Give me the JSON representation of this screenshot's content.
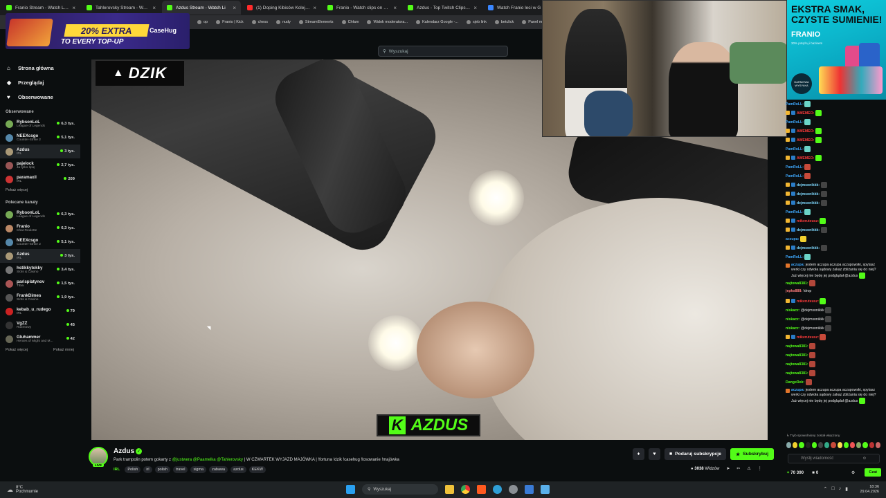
{
  "browser": {
    "tabs": [
      {
        "title": "Franio Stream - Watch Live on",
        "color": "#53fc18",
        "active": false
      },
      {
        "title": "Tahlerovsky Stream - Watch Li",
        "color": "#53fc18",
        "active": false
      },
      {
        "title": "Azdus Stream - Watch Li",
        "color": "#53fc18",
        "active": true
      },
      {
        "title": "(1) Doping Kibiców Kolejorza",
        "color": "#ff2b2b",
        "active": false
      },
      {
        "title": "Franio - Watch clips on Kick",
        "color": "#53fc18",
        "active": false
      },
      {
        "title": "Azdus - Top Twitch Clips - Twi",
        "color": "#53fc18",
        "active": false
      },
      {
        "title": "Watch Franio leci w G",
        "color": "#3a86ff",
        "active": false
      }
    ],
    "bookmarks": [
      "op",
      "Franio | Kick",
      "chess",
      "nudy",
      "StreamElements",
      "Chłam",
      "Widok moderatora...",
      "Kalendarz Google -...",
      "sjeb link",
      "betclick",
      "Panel mode"
    ]
  },
  "ad_banner": {
    "line1": "20% EXTRA",
    "line2": "TO EVERY TOP-UP",
    "brand": "CaseHug"
  },
  "search": {
    "placeholder": "Wyszukaj"
  },
  "sidebar": {
    "nav": [
      {
        "label": "Strona główna",
        "icon": "home-icon"
      },
      {
        "label": "Przeglądaj",
        "icon": "compass-icon"
      },
      {
        "label": "Obserwowane",
        "icon": "heart-icon"
      }
    ],
    "followed_header": "Obserwowane",
    "followed": [
      {
        "name": "RybsonLoL",
        "cat": "League of Legends",
        "viewers": "6,3 tys.",
        "color": "#7a5"
      },
      {
        "name": "NEEXcsgo",
        "cat": "Counter-Strike 2",
        "viewers": "5,1 tys.",
        "color": "#58a"
      },
      {
        "name": "Azdus",
        "cat": "IRL",
        "viewers": "3 tys.",
        "color": "#a97",
        "selected": true
      },
      {
        "name": "pajelock",
        "cat": "Ja tylko śpię",
        "viewers": "2,7 tys.",
        "color": "#955"
      },
      {
        "name": "paramaxil",
        "cat": "IRL",
        "viewers": "209",
        "color": "#c33"
      }
    ],
    "followed_more": "Pokaż więcej",
    "recommended_header": "Polecane kanały",
    "recommended": [
      {
        "name": "RybsonLoL",
        "cat": "League of Legends",
        "viewers": "6,3 tys.",
        "color": "#7a5"
      },
      {
        "name": "Franio",
        "cat": "Chat Roulette",
        "viewers": "6,3 tys.",
        "color": "#b86"
      },
      {
        "name": "NEEXcsgo",
        "cat": "Counter-Strike 2",
        "viewers": "5,1 tys.",
        "color": "#58a"
      },
      {
        "name": "Azdus",
        "cat": "IRL",
        "viewers": "3 tys.",
        "color": "#a97",
        "selected": true
      },
      {
        "name": "hstikkytokky",
        "cat": "Slots & Casino",
        "viewers": "3,4 tys.",
        "color": "#777"
      },
      {
        "name": "parisplatynov",
        "cat": "Tibia",
        "viewers": "1,5 tys.",
        "color": "#a55"
      },
      {
        "name": "FrankDimes",
        "cat": "Slots & Casino",
        "viewers": "1,9 tys.",
        "color": "#555"
      },
      {
        "name": "kebab_u_rudego",
        "cat": "IRL",
        "viewers": "79",
        "color": "#c22"
      },
      {
        "name": "VgZZ",
        "cat": "Rozmowy",
        "viewers": "45",
        "color": "#333"
      },
      {
        "name": "Gluhammer",
        "cat": "Heroes of Might and M...",
        "viewers": "42",
        "color": "#665"
      }
    ],
    "more": "Pokaż więcej",
    "less": "Pokaż mniej"
  },
  "overlay": {
    "dzik": "DZIK",
    "kick_k": "K",
    "kick_name": "AZDUS"
  },
  "webcam_ad": {
    "line1": "EKSTRA SMAK,",
    "line2": "CZYSTE SUMIENIE!",
    "brand": "FRANIO",
    "sub": "30% potężej i bazinem",
    "badge": "DARMOWA WYSYŁKA"
  },
  "chat": {
    "messages": [
      {
        "user": "PamRoLL:",
        "ucolor": "#3fa9ff",
        "text": "",
        "emote": "#6bd4c8"
      },
      {
        "user": "AWEMEO:",
        "ucolor": "#ff3b3b",
        "text": "",
        "emote": "#53fc18",
        "badges": true
      },
      {
        "user": "PamRoLL:",
        "ucolor": "#3fa9ff",
        "text": "",
        "emote": "#6bd4c8"
      },
      {
        "user": "AWEMEO:",
        "ucolor": "#ff3b3b",
        "text": "",
        "emote": "#53fc18",
        "badges": true
      },
      {
        "user": "AWEMEO:",
        "ucolor": "#ff3b3b",
        "text": "",
        "emote": "#53fc18",
        "badges": true
      },
      {
        "user": "PamRoLL:",
        "ucolor": "#3fa9ff",
        "text": "",
        "emote": "#6bd4c8"
      },
      {
        "user": "AWEMEO:",
        "ucolor": "#ff3b3b",
        "text": "",
        "emote": "#53fc18",
        "badges": true
      },
      {
        "user": "PamRoLL:",
        "ucolor": "#3fa9ff",
        "text": "",
        "emote": "#c84a3a"
      },
      {
        "user": "PamRoLL:",
        "ucolor": "#3fa9ff",
        "text": "",
        "emote": "#c84a3a"
      },
      {
        "user": "dejmsonikkk:",
        "ucolor": "#7fd9ff",
        "text": "",
        "emote": "#444",
        "badges": true
      },
      {
        "user": "dejmsonikkk:",
        "ucolor": "#7fd9ff",
        "text": "",
        "emote": "#444",
        "badges": true
      },
      {
        "user": "dejmsonikkk:",
        "ucolor": "#7fd9ff",
        "text": "",
        "emote": "#444",
        "badges": true
      },
      {
        "user": "PamRoLL:",
        "ucolor": "#3fa9ff",
        "text": "",
        "emote": "#6bd4c8"
      },
      {
        "user": "mikeruteusz:",
        "ucolor": "#ff3b3b",
        "text": "",
        "emote": "#53fc18",
        "badges": true
      },
      {
        "user": "dejmsonikkk:",
        "ucolor": "#7fd9ff",
        "text": "",
        "emote": "#444",
        "badges": true
      },
      {
        "user": "aczupa:",
        "ucolor": "#3fa9ff",
        "text": "",
        "emote": "#f2d12e"
      },
      {
        "user": "dejmsonikkk:",
        "ucolor": "#7fd9ff",
        "text": "",
        "emote": "#444",
        "badges": true
      },
      {
        "user": "PamRoLL:",
        "ucolor": "#3fa9ff",
        "text": "",
        "emote": "#6bd4c8"
      },
      {
        "user": "aczupa:",
        "ucolor": "#3fa9ff",
        "text": "jestem aczupa aczupa aczupowski, spytasz werki czy odwoła sądowy zakaz zbliżania się do niej? Już więcej nie będę jej podglądał @azdus",
        "emote": "#53fc18",
        "tall": true
      },
      {
        "user": "najtowa8381:",
        "ucolor": "#53fc18",
        "text": "",
        "emote": "#b3473a"
      },
      {
        "user": "jepko888:",
        "ucolor": "#ff7b7b",
        "text": "!drop",
        "emote": ""
      },
      {
        "user": "mikeruteusz:",
        "ucolor": "#ff3b3b",
        "text": "",
        "emote": "#53fc18",
        "badges": true
      },
      {
        "user": "niskacz:",
        "ucolor": "#53fc18",
        "text": "@dejmsonikkk",
        "emote": "#444"
      },
      {
        "user": "niskacz:",
        "ucolor": "#53fc18",
        "text": "@dejmsonikkk",
        "emote": "#444"
      },
      {
        "user": "niskacz:",
        "ucolor": "#53fc18",
        "text": "@dejmsonikkk",
        "emote": "#444"
      },
      {
        "user": "mikeruteusz:",
        "ucolor": "#ff3b3b",
        "text": "",
        "emote": "#c84a3a",
        "badges": true
      },
      {
        "user": "najtowa8381:",
        "ucolor": "#53fc18",
        "text": "",
        "emote": "#b3473a"
      },
      {
        "user": "najtowa8381:",
        "ucolor": "#53fc18",
        "text": "",
        "emote": "#b3473a"
      },
      {
        "user": "najtowa8381:",
        "ucolor": "#53fc18",
        "text": "",
        "emote": "#b3473a"
      },
      {
        "user": "najtowa8381:",
        "ucolor": "#53fc18",
        "text": "",
        "emote": "#b3473a"
      },
      {
        "user": "DangeRek:",
        "ucolor": "#53fc18",
        "text": "",
        "emote": "#b3473a"
      },
      {
        "user": "aczupa:",
        "ucolor": "#3fa9ff",
        "text": "jestem aczupa aczupa aczupowski, spytasz werki czy odwoła sądowy zakaz zbliżania się do niej? Już więcej nie będę jej podglądał @azdus",
        "emote": "#53fc18",
        "tall": true
      }
    ],
    "slow_mode": "Tryb spowolniony został włączony",
    "input_placeholder": "Wyślij wiadomość",
    "points": "70 390",
    "zero": "0",
    "chat_button": "Czat"
  },
  "stream": {
    "name": "Azdus",
    "live": "LIVE",
    "title_pre": "Park trampolin potem gokarty z ",
    "mentions": "@justwera @Paamelka @Tahlerovsky",
    "title_post": " | W CZWARTEK WYJAZD MAJÓWKA | !fortuna !dzik !casehug !losowanie !majówka",
    "category": "IRL",
    "tags": [
      "Polish",
      "irl",
      "polish",
      "travel",
      "sigma",
      "zabawa",
      "azdus",
      "KEKW"
    ],
    "gift_label": "Podaruj subskrypcje",
    "subscribe_label": "Subskrybuj",
    "viewers": "3038",
    "viewers_label": "Widzów"
  },
  "taskbar": {
    "temp": "8°C",
    "weather": "Pochmurnie",
    "search": "Wyszukaj",
    "time": "18:36",
    "date": "29.04.2026"
  },
  "colors": {
    "kick_green": "#53fc18",
    "bg": "#0b0e0f"
  }
}
